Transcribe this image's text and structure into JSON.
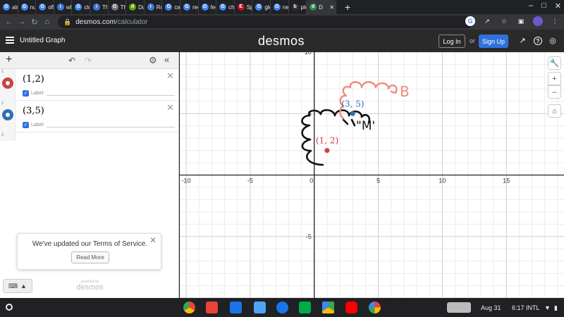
{
  "browser": {
    "tabs": [
      {
        "label": "alma",
        "color": "#4285f4",
        "glyph": "G"
      },
      {
        "label": "num",
        "color": "#4285f4",
        "glyph": "G"
      },
      {
        "label": "offic",
        "color": "#4285f4",
        "glyph": "G"
      },
      {
        "label": "what",
        "color": "#3b7bd4",
        "glyph": "i"
      },
      {
        "label": "cloth",
        "color": "#4285f4",
        "glyph": "G"
      },
      {
        "label": "Ther",
        "color": "#3b7bd4",
        "glyph": "i"
      },
      {
        "label": "The",
        "color": "#777777",
        "glyph": "O"
      },
      {
        "label": "Duo",
        "color": "#58a700",
        "glyph": "d"
      },
      {
        "label": "Run",
        "color": "#3b7bd4",
        "glyph": "i"
      },
      {
        "label": "cart",
        "color": "#4285f4",
        "glyph": "G"
      },
      {
        "label": "rece",
        "color": "#4285f4",
        "glyph": "G"
      },
      {
        "label": "feeli",
        "color": "#4285f4",
        "glyph": "G"
      },
      {
        "label": "char",
        "color": "#4285f4",
        "glyph": "G"
      },
      {
        "label": "Spa",
        "color": "#c60b1e",
        "glyph": "E"
      },
      {
        "label": "glea",
        "color": "#4285f4",
        "glyph": "G"
      },
      {
        "label": "neg",
        "color": "#4285f4",
        "glyph": "G"
      },
      {
        "label": "plea",
        "color": "#333333",
        "glyph": "b"
      },
      {
        "label": "D",
        "color": "#2e8b57",
        "glyph": "d",
        "active": true
      }
    ],
    "new_tab": "+",
    "url_host": "desmos.com",
    "url_path": "/calculator"
  },
  "header": {
    "title": "Untitled Graph",
    "logo": "desmos",
    "login": "Log In",
    "or": "or",
    "signup": "Sign Up"
  },
  "expressions": [
    {
      "index": "1",
      "latex": "(1,2)",
      "color": "#c74440",
      "label_text": "Label:"
    },
    {
      "index": "2",
      "latex": "(3,5)",
      "color": "#2d70b3",
      "label_text": "Label:"
    }
  ],
  "empty_index": "3",
  "tos": {
    "message": "We've updated our Terms of Service.",
    "button": "Read More"
  },
  "powered": {
    "line1": "powered by",
    "line2": "desmos"
  },
  "graph": {
    "xlim": [
      -10.5,
      19.5
    ],
    "ylim": [
      -10,
      10
    ],
    "x_ticks": [
      "-10",
      "-5",
      "0",
      "5",
      "10",
      "15"
    ],
    "y_ticks": [
      "10",
      "5",
      "-5"
    ],
    "points": [
      {
        "x": 1,
        "y": 2,
        "label": "(1, 2)",
        "color": "#c74440"
      },
      {
        "x": 3,
        "y": 5,
        "label": "(3, 5)",
        "color": "#2d70b3"
      }
    ],
    "annotations": {
      "black_text": "\"M'",
      "red_text": "B"
    }
  },
  "taskbar": {
    "date": "Aug 31",
    "time": "6:17",
    "locale": "INTL"
  }
}
